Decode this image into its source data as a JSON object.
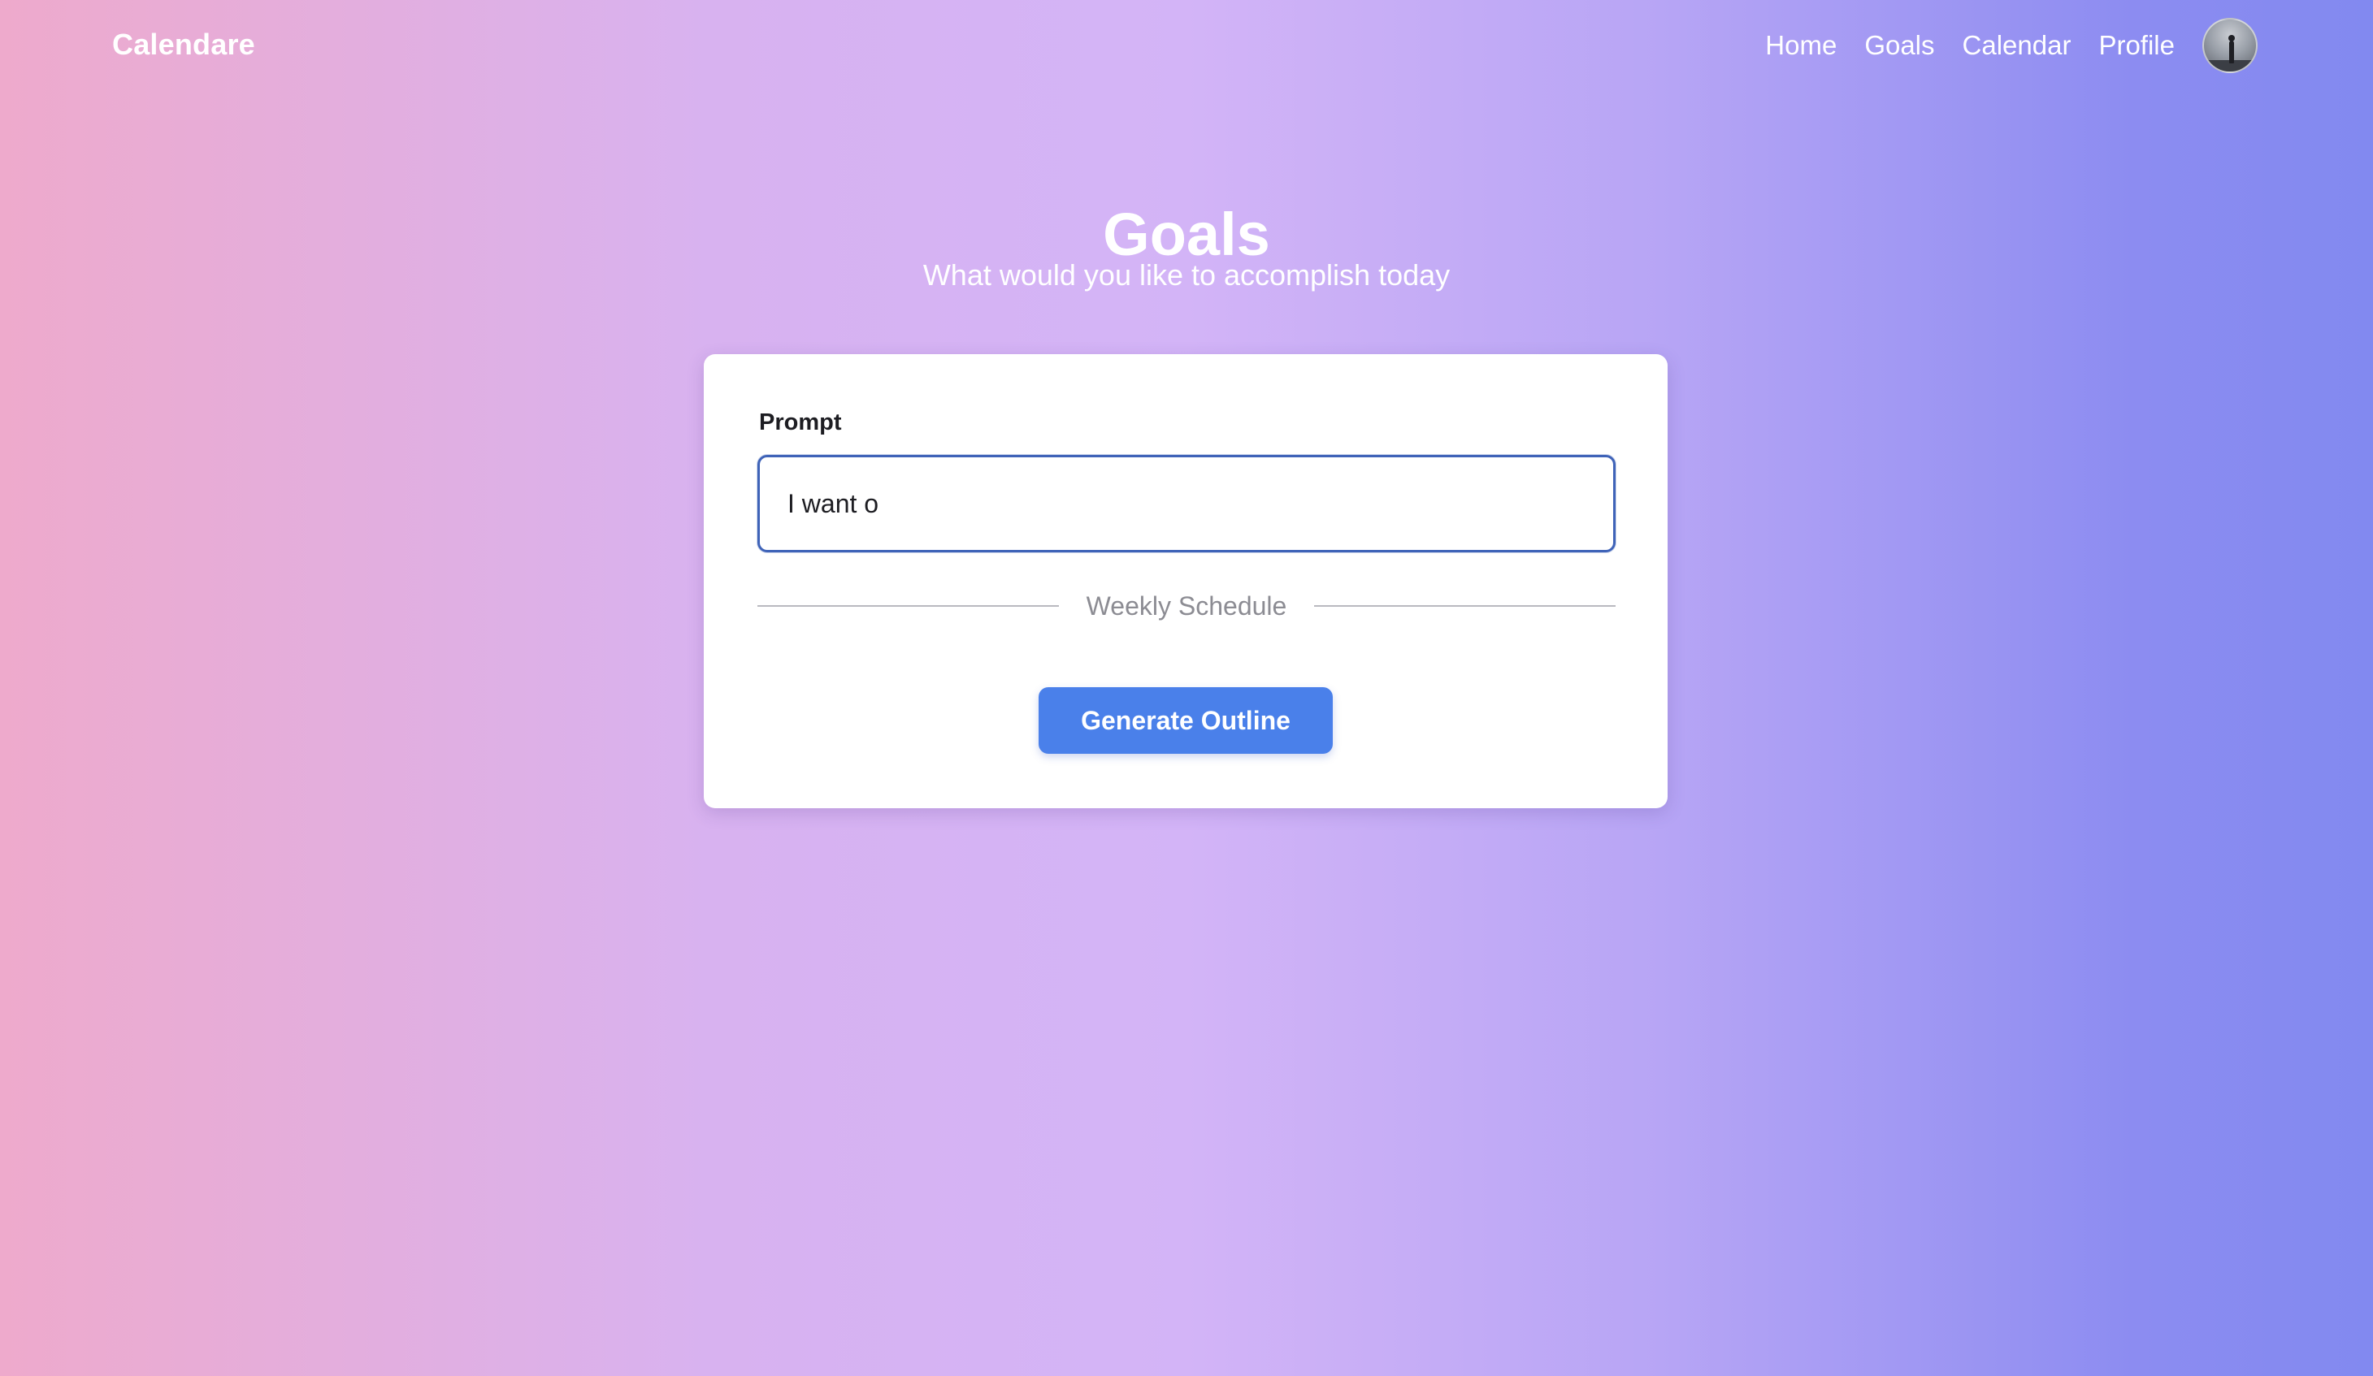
{
  "header": {
    "brand": "Calendare",
    "nav": [
      {
        "label": "Home"
      },
      {
        "label": "Goals"
      },
      {
        "label": "Calendar"
      },
      {
        "label": "Profile"
      }
    ],
    "avatar_icon": "user-avatar-photo"
  },
  "main": {
    "title": "Goals",
    "subtitle": "What would you like to accomplish today"
  },
  "form": {
    "prompt_label": "Prompt",
    "prompt_value": "I want o",
    "divider_text": "Weekly Schedule",
    "generate_label": "Generate Outline"
  },
  "colors": {
    "gradient_start": "#eeaacc",
    "gradient_mid": "#d3b4f7",
    "gradient_end": "#8289f0",
    "input_border": "#3f63b8",
    "button_bg": "#4a80ea",
    "card_bg": "#ffffff"
  }
}
